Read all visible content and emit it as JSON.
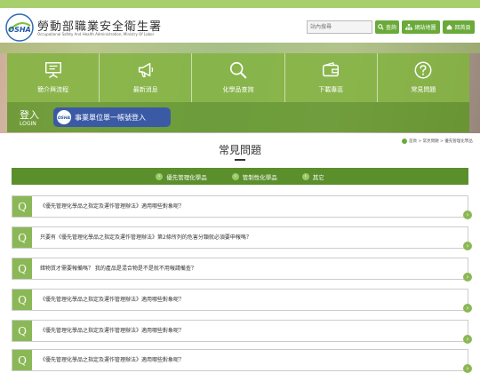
{
  "header": {
    "logo_text": "OSHA",
    "title": "勞動部職業安全衛生署",
    "subtitle": "Occupational Safety And Health Administration, Ministry Of Labor",
    "search_placeholder": "站內搜尋",
    "search_button": "查詢",
    "sitemap_button": "網站地圖",
    "home_button": "回首頁"
  },
  "nav": {
    "items": [
      {
        "label": "簡介與流程",
        "icon": "presentation-board-icon"
      },
      {
        "label": "最新消息",
        "icon": "megaphone-icon"
      },
      {
        "label": "化學品查詢",
        "icon": "magnifier-icon"
      },
      {
        "label": "下載專區",
        "icon": "wallet-icon"
      },
      {
        "label": "常見問題",
        "icon": "question-circle-icon"
      }
    ]
  },
  "login": {
    "label_cn": "登入",
    "label_en": "LOGIN",
    "logo_text": "OSHA",
    "button_label": "事業單位單一帳號登入"
  },
  "page": {
    "title": "常見問題",
    "breadcrumb": "首頁 > 常見問題 > 優先管理化學品"
  },
  "tabs": [
    {
      "label": "優先管理化學品"
    },
    {
      "label": "管制性化學品"
    },
    {
      "label": "其它"
    }
  ],
  "faqs": [
    {
      "q": "Q",
      "text": "《優先管理化學品之指定及運作管理辦法》適用哪些對象呢？"
    },
    {
      "q": "Q",
      "text": "只要有《優先管理化學品之指定及運作管理辦法》第2條所列的危害分類就必須要申報嗎？"
    },
    {
      "q": "Q",
      "text": "錯物質才需要報備嗎？ 我的產品是混合物是不是就不用報請備查？"
    },
    {
      "q": "Q",
      "text": "《優先管理化學品之指定及運作管理辦法》適用哪些對象呢？"
    },
    {
      "q": "Q",
      "text": "《優先管理化學品之指定及運作管理辦法》適用哪些對象呢？"
    },
    {
      "q": "Q",
      "text": "《優先管理化學品之指定及運作管理辦法》適用哪些對象呢？"
    }
  ],
  "colors": {
    "accent_green": "#6aaa3a",
    "nav_green": "#83b440",
    "tab_green": "#5a8f2b",
    "login_blue": "#3b5aa5"
  }
}
